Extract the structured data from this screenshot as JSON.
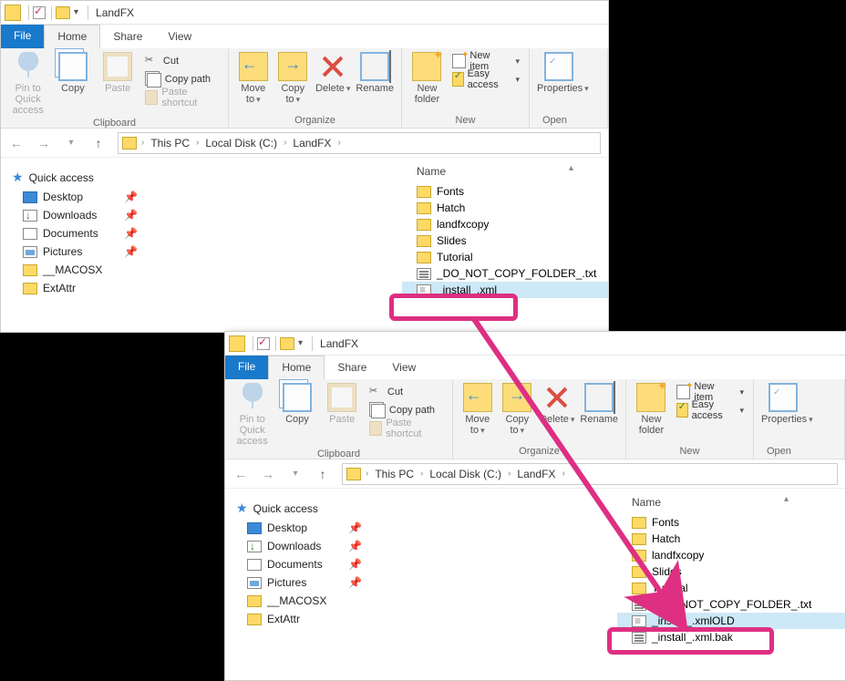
{
  "window1": {
    "title": "LandFX",
    "tabs": {
      "file": "File",
      "home": "Home",
      "share": "Share",
      "view": "View"
    },
    "ribbon": {
      "pin": "Pin to Quick access",
      "copy": "Copy",
      "paste": "Paste",
      "cut": "Cut",
      "copypath": "Copy path",
      "pasteshort": "Paste shortcut",
      "clipboard": "Clipboard",
      "moveto": "Move to",
      "copyto": "Copy to",
      "delete": "Delete",
      "rename": "Rename",
      "organize": "Organize",
      "newfolder": "New folder",
      "newitem": "New item",
      "easyaccess": "Easy access",
      "new": "New",
      "properties": "Properties",
      "open": "Open"
    },
    "breadcrumbs": [
      "This PC",
      "Local Disk (C:)",
      "LandFX"
    ],
    "nav": {
      "quick": "Quick access",
      "desktop": "Desktop",
      "downloads": "Downloads",
      "documents": "Documents",
      "pictures": "Pictures",
      "macosx": "__MACOSX",
      "extattr": "ExtAttr"
    },
    "filehdr": {
      "name": "Name"
    },
    "files": [
      {
        "type": "folder",
        "name": "Fonts"
      },
      {
        "type": "folder",
        "name": "Hatch"
      },
      {
        "type": "folder",
        "name": "landfxcopy"
      },
      {
        "type": "folder",
        "name": "Slides"
      },
      {
        "type": "folder",
        "name": "Tutorial"
      },
      {
        "type": "file",
        "name": "_DO_NOT_COPY_FOLDER_.txt"
      },
      {
        "type": "xml",
        "name": "_install_.xml"
      }
    ]
  },
  "window2": {
    "title": "LandFX",
    "tabs": {
      "file": "File",
      "home": "Home",
      "share": "Share",
      "view": "View"
    },
    "ribbon": {
      "pin": "Pin to Quick access",
      "copy": "Copy",
      "paste": "Paste",
      "cut": "Cut",
      "copypath": "Copy path",
      "pasteshort": "Paste shortcut",
      "clipboard": "Clipboard",
      "moveto": "Move to",
      "copyto": "Copy to",
      "delete": "Delete",
      "rename": "Rename",
      "organize": "Organize",
      "newfolder": "New folder",
      "newitem": "New item",
      "easyaccess": "Easy access",
      "new": "New",
      "properties": "Properties",
      "open": "Open"
    },
    "breadcrumbs": [
      "This PC",
      "Local Disk (C:)",
      "LandFX"
    ],
    "nav": {
      "quick": "Quick access",
      "desktop": "Desktop",
      "downloads": "Downloads",
      "documents": "Documents",
      "pictures": "Pictures",
      "macosx": "__MACOSX",
      "extattr": "ExtAttr"
    },
    "filehdr": {
      "name": "Name"
    },
    "files": [
      {
        "type": "folder",
        "name": "Fonts"
      },
      {
        "type": "folder",
        "name": "Hatch"
      },
      {
        "type": "folder",
        "name": "landfxcopy"
      },
      {
        "type": "folder",
        "name": "Slides"
      },
      {
        "type": "folder",
        "name": "Tutorial"
      },
      {
        "type": "file",
        "name": "_DO_NOT_COPY_FOLDER_.txt"
      },
      {
        "type": "xml",
        "name": "_install_.xmlOLD"
      },
      {
        "type": "file",
        "name": "_install_.xml.bak"
      }
    ]
  },
  "highlight1_file": "_install_.xml",
  "highlight2_file": "_install_.xmlOLD"
}
